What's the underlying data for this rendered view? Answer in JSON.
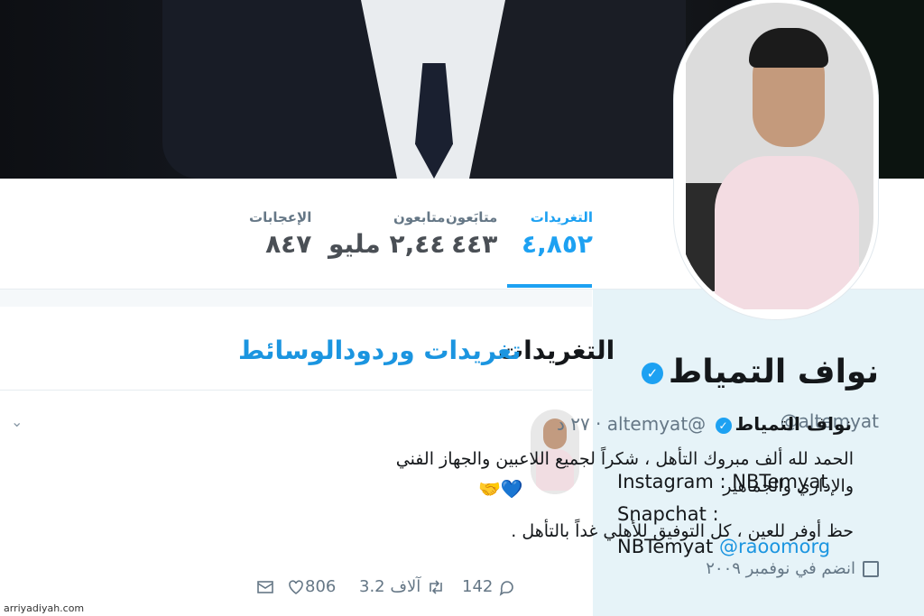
{
  "stats": [
    {
      "label": "التغريدات",
      "value": "٤,٨٥٢",
      "active": true
    },
    {
      "label": "متابَعون",
      "value": "٤٤٣"
    },
    {
      "label": "متابعون",
      "value": "٢,٤٤ مليو"
    },
    {
      "label": "الإعجابات",
      "value": "٨٤٧"
    }
  ],
  "tabs": {
    "tweets": "التغريدات",
    "replies": "تغريدات وردود",
    "media": "الوسائط"
  },
  "profile": {
    "name": "نواف التمياط",
    "handle": "@altemyat",
    "bio_line1": "Instagram : NBTemyat Snapchat :",
    "bio_line2_text": "NBTemyat ",
    "bio_link": "@raoomorg",
    "joined": "انضم في نوفمبر ٢٠٠٩"
  },
  "tweet": {
    "name": "نواف التمياط",
    "handle": "@altemyat",
    "time": "· ٢٧ د",
    "line1": "الحمد لله ألف مبروك التأهل ، شكراً لجميع اللاعبين والجهاز الفني والإداري والجماهير",
    "line2": "حظ أوفر للعين ، كل التوفيق للأهلي غداً بالتأهل .",
    "emoji": "🤝💙",
    "replies": "142",
    "retweets": "3.2 آلاف",
    "likes": "806"
  },
  "icons": {
    "verified": "verified-badge-icon",
    "calendar": "calendar-icon",
    "reply": "reply-icon",
    "retweet": "retweet-icon",
    "like": "heart-icon",
    "dm": "mail-icon",
    "caret": "chevron-down-icon"
  },
  "colors": {
    "accent": "#1da1f2",
    "link": "#1b95e0",
    "sidebar": "#e6f3f8"
  },
  "watermark": "arriyadiyah.com"
}
